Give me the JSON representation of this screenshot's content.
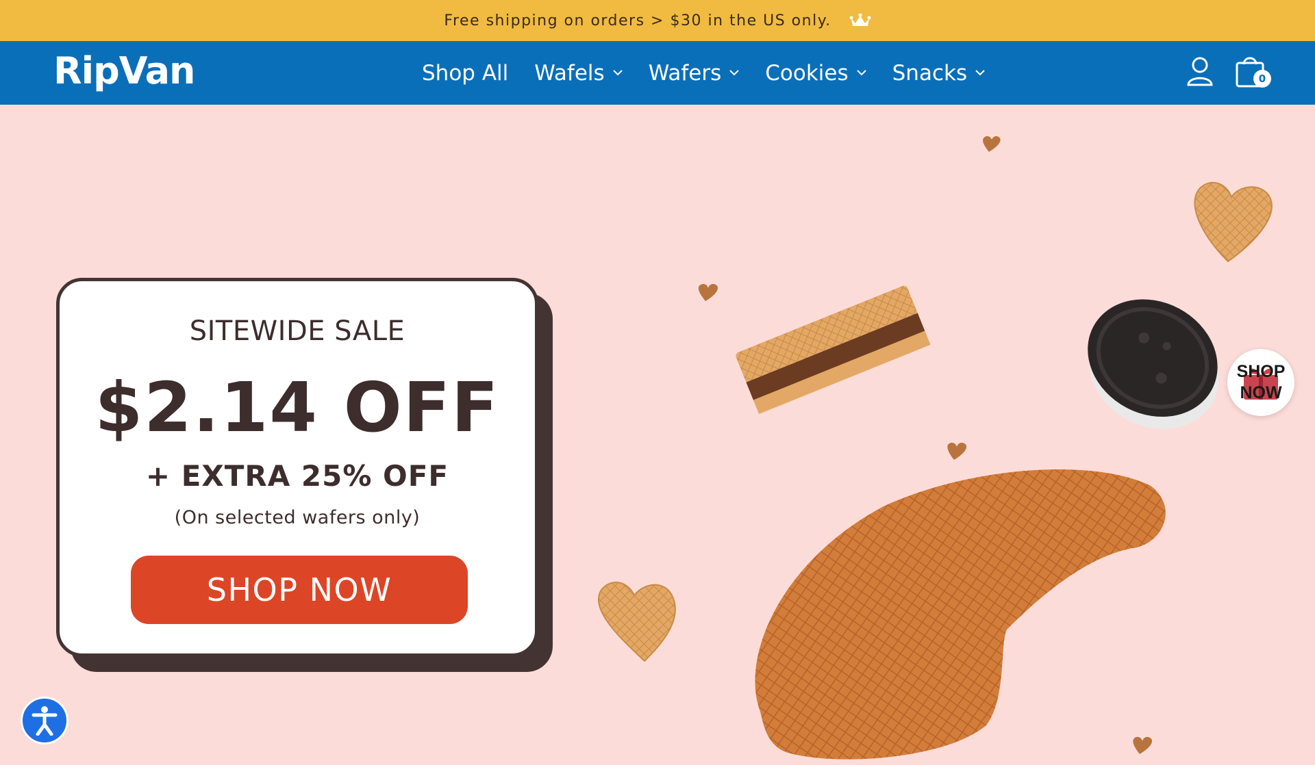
{
  "announcement": {
    "text": "Free shipping on orders > $30 in the US only.",
    "icon": "crown-icon"
  },
  "header": {
    "logo": "RipVan",
    "nav": [
      {
        "label": "Shop All",
        "has_dropdown": false
      },
      {
        "label": "Wafels",
        "has_dropdown": true
      },
      {
        "label": "Wafers",
        "has_dropdown": true
      },
      {
        "label": "Cookies",
        "has_dropdown": true
      },
      {
        "label": "Snacks",
        "has_dropdown": true
      }
    ],
    "account_icon": "account-icon",
    "cart_icon": "cart-icon",
    "cart_count": "0"
  },
  "promo": {
    "eyebrow": "SITEWIDE SALE",
    "headline": "$2.14 OFF",
    "subline": "+ EXTRA 25% OFF",
    "note": "(On selected wafers only)",
    "cta": "SHOP NOW"
  },
  "floating_badge": {
    "text": "SHOP NOW"
  },
  "accessibility_icon": "accessibility-icon",
  "colors": {
    "announcement_bg": "#f1bb41",
    "header_bg": "#0a6fb9",
    "page_bg": "#fcdcd8",
    "card_text": "#3d2d2d",
    "cta_bg": "#dd4527"
  }
}
